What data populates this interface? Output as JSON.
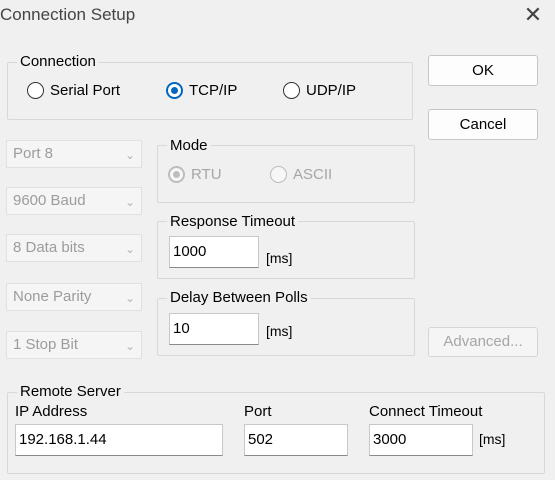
{
  "window": {
    "title": "Connection Setup",
    "close_glyph": "✕"
  },
  "connection": {
    "legend": "Connection",
    "options": [
      "Serial Port",
      "TCP/IP",
      "UDP/IP"
    ],
    "selected": "TCP/IP"
  },
  "buttons": {
    "ok": "OK",
    "cancel": "Cancel",
    "advanced": "Advanced..."
  },
  "serial": {
    "port": "Port 8",
    "baud": "9600 Baud",
    "data_bits": "8 Data bits",
    "parity": "None Parity",
    "stop_bits": "1 Stop Bit"
  },
  "mode": {
    "legend": "Mode",
    "options": [
      "RTU",
      "ASCII"
    ],
    "selected": "RTU"
  },
  "response_timeout": {
    "legend": "Response Timeout",
    "value": "1000",
    "unit": "[ms]"
  },
  "delay_between_polls": {
    "legend": "Delay Between Polls",
    "value": "10",
    "unit": "[ms]"
  },
  "remote_server": {
    "legend": "Remote Server",
    "ip_label": "IP Address",
    "ip_value": "192.168.1.44",
    "port_label": "Port",
    "port_value": "502",
    "timeout_label": "Connect Timeout",
    "timeout_value": "3000",
    "timeout_unit": "[ms]"
  },
  "icons": {
    "chevron": "chevron-down-icon",
    "close": "close-icon"
  },
  "colors": {
    "accent": "#0067c0",
    "background": "#f0f0f0"
  }
}
